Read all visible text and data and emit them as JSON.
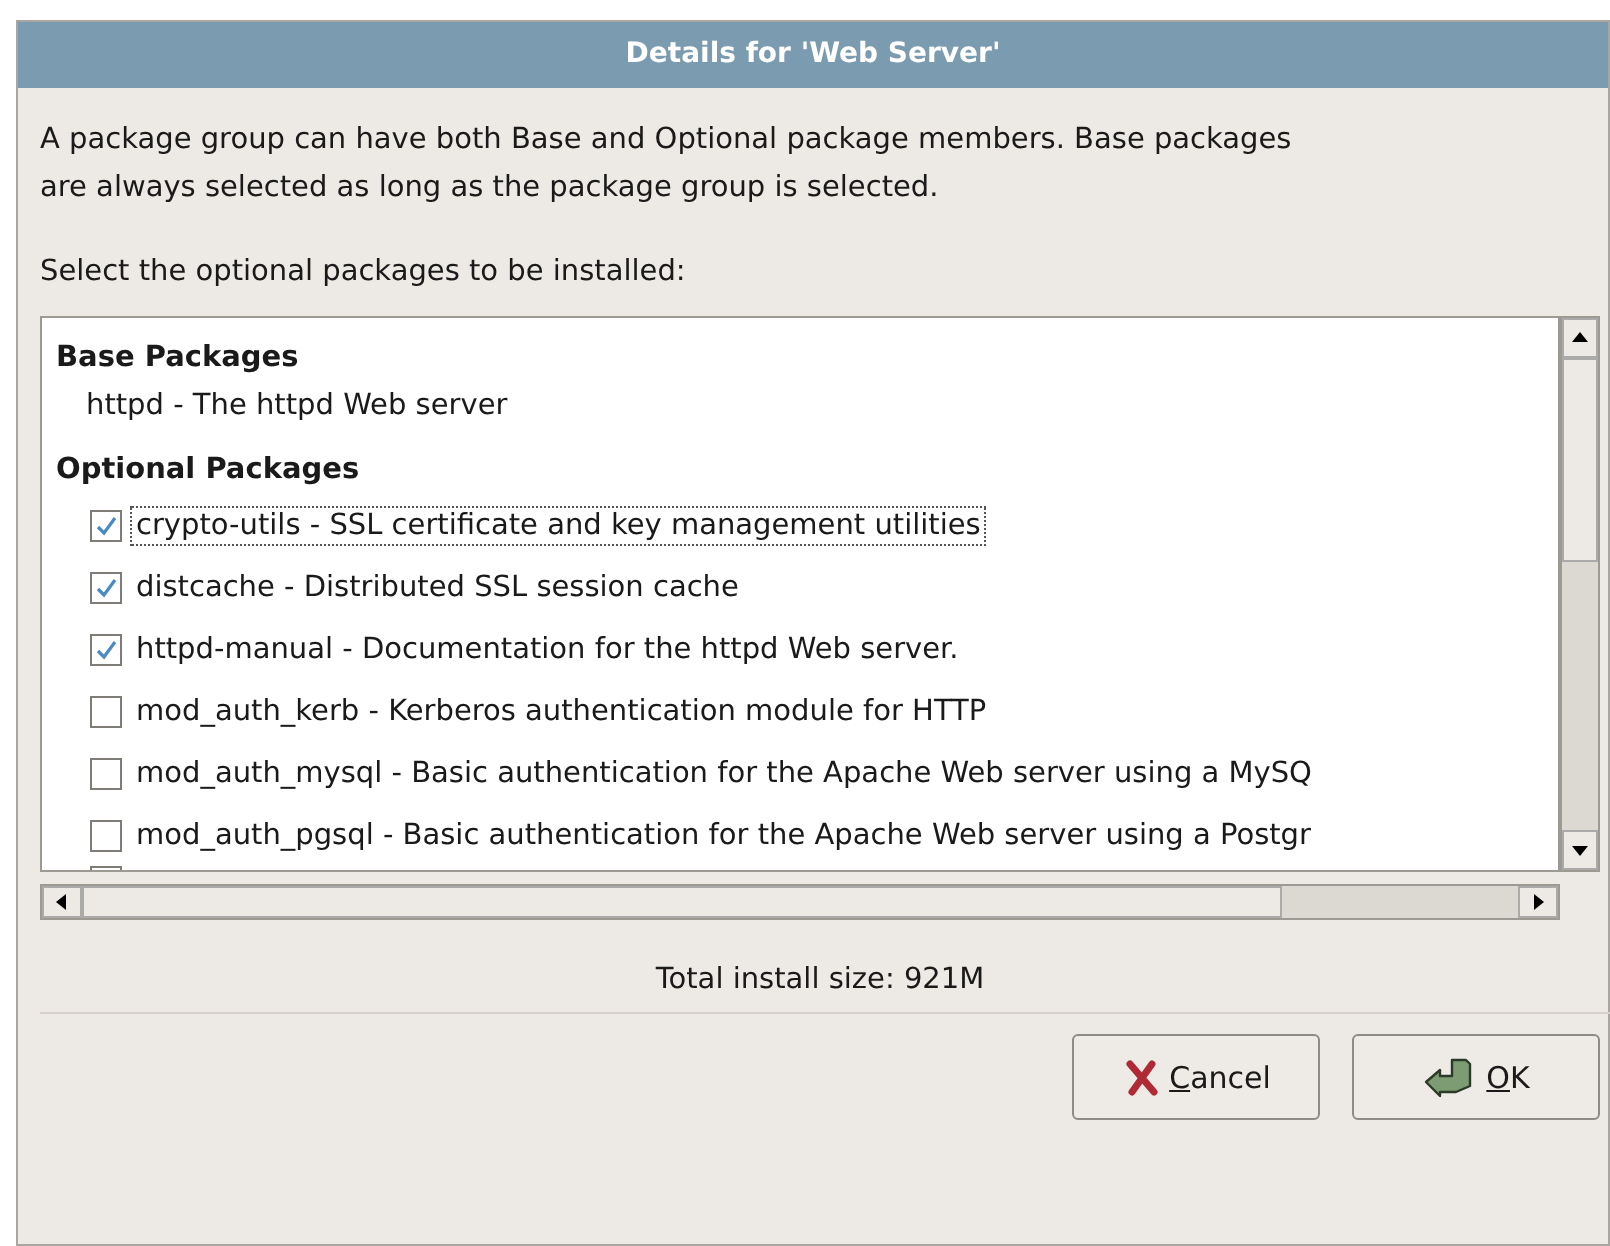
{
  "window": {
    "title": "Details for 'Web Server'"
  },
  "description": "A package group can have both Base and Optional package members.  Base packages are always selected as long as the package group is selected.",
  "prompt": "Select the optional packages to be installed:",
  "base_heading": "Base Packages",
  "base_packages": [
    "httpd - The httpd Web server"
  ],
  "optional_heading": "Optional Packages",
  "optional_packages": [
    {
      "label": "crypto-utils - SSL certificate and key management utilities",
      "checked": true,
      "focused": true
    },
    {
      "label": "distcache - Distributed SSL session cache",
      "checked": true,
      "focused": false
    },
    {
      "label": "httpd-manual - Documentation for the httpd Web server.",
      "checked": true,
      "focused": false
    },
    {
      "label": "mod_auth_kerb - Kerberos authentication module for HTTP",
      "checked": false,
      "focused": false
    },
    {
      "label": "mod_auth_mysql - Basic authentication for the Apache Web server using a MySQ",
      "checked": false,
      "focused": false
    },
    {
      "label": "mod_auth_pgsql - Basic authentication for the Apache Web server using a Postgr",
      "checked": false,
      "focused": false
    }
  ],
  "total_size": "Total install size: 921M",
  "buttons": [
    {
      "kind": "cancel",
      "label": "Cancel"
    },
    {
      "kind": "ok",
      "label": "OK"
    }
  ]
}
